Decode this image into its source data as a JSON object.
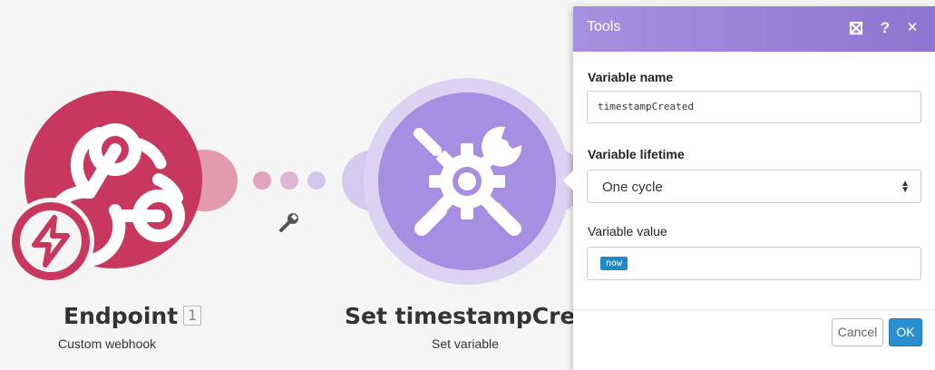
{
  "modules": [
    {
      "title": "Endpoint",
      "count": "1",
      "subtitle": "Custom webhook",
      "color": "#c8375e"
    },
    {
      "title": "Set timestampCreated",
      "subtitle": "Set variable",
      "color": "#a78ee2"
    }
  ],
  "panel": {
    "title": "Tools",
    "header_icons": [
      "expand-icon",
      "help-icon",
      "close-icon"
    ],
    "help_glyph": "?",
    "close_glyph": "✕",
    "fields": {
      "variable_name_label": "Variable name",
      "variable_name_value": "timestampCreated",
      "variable_lifetime_label": "Variable lifetime",
      "variable_lifetime_value": "One cycle",
      "variable_value_label": "Variable value",
      "variable_value_pill": "now"
    },
    "buttons": {
      "cancel": "Cancel",
      "ok": "OK"
    },
    "accent_color": "#2a8fd0",
    "header_color": "#9a80d8"
  }
}
